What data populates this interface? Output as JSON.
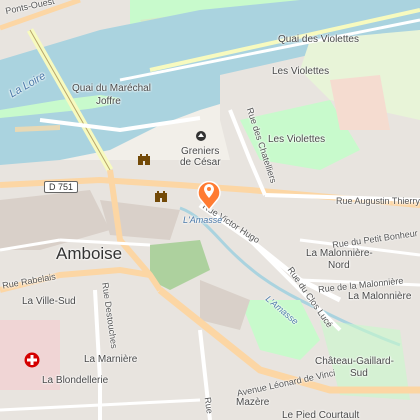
{
  "map": {
    "labels": {
      "ponts_ouest": "Ponts-Ouest",
      "la_loire": "La Loire",
      "quai_violettes": "Quai des Violettes",
      "les_violettes_top": "Les Violettes",
      "quai_marechal": "Quai du Maréchal",
      "joffre": "Joffre",
      "rue_chatelliers": "Rue des Chatelliers",
      "les_violettes_mid": "Les Violettes",
      "greniers_1": "Greniers",
      "greniers_2": "de César",
      "d751": "D 751",
      "rue_augustin_thierry": "Rue Augustin Thierry",
      "rue_victor_hugo": "Rue Victor Hugo",
      "amasse_1": "L'Amasse",
      "amboise": "Amboise",
      "rue_petit_bonheur": "Rue du Petit Bonheur",
      "rue_rabelais": "Rue Rabelais",
      "malonniere_nord_1": "La Malonnière-",
      "malonniere_nord_2": "Nord",
      "rue_malonniere": "Rue de la Malonnière",
      "rue_clos_luce": "Rue du Clos Lucé",
      "la_ville_sud": "La Ville-Sud",
      "rue_destouches": "Rue Destouches",
      "la_malonniere": "La Malonnière",
      "amasse_2": "L'Amasse",
      "la_marniere": "La Marnière",
      "chateau_gaillard_1": "Château-Gaillard-",
      "chateau_gaillard_2": "Sud",
      "la_blondellerie": "La Blondellerie",
      "avenue_leonard": "Avenue Léonard de Vinci",
      "mazere": "Mazère",
      "le_pied_courtault": "Le Pied Courtault",
      "rue_partial": "Rue"
    },
    "colors": {
      "water": "#aad3df",
      "park": "#c8facc",
      "forest": "#add19e",
      "landuse": "#f2efe9",
      "residential": "#e0dfdf",
      "building": "#d9d0c9",
      "road_major": "#f7fabf",
      "road_primary": "#fcd6a4",
      "road_minor": "#ffffff",
      "marker": "#ff7b32"
    },
    "icons": {
      "castle": "castle-icon",
      "viewpoint": "viewpoint-icon",
      "hospital": "hospital-icon",
      "marker": "location-marker-icon"
    }
  }
}
